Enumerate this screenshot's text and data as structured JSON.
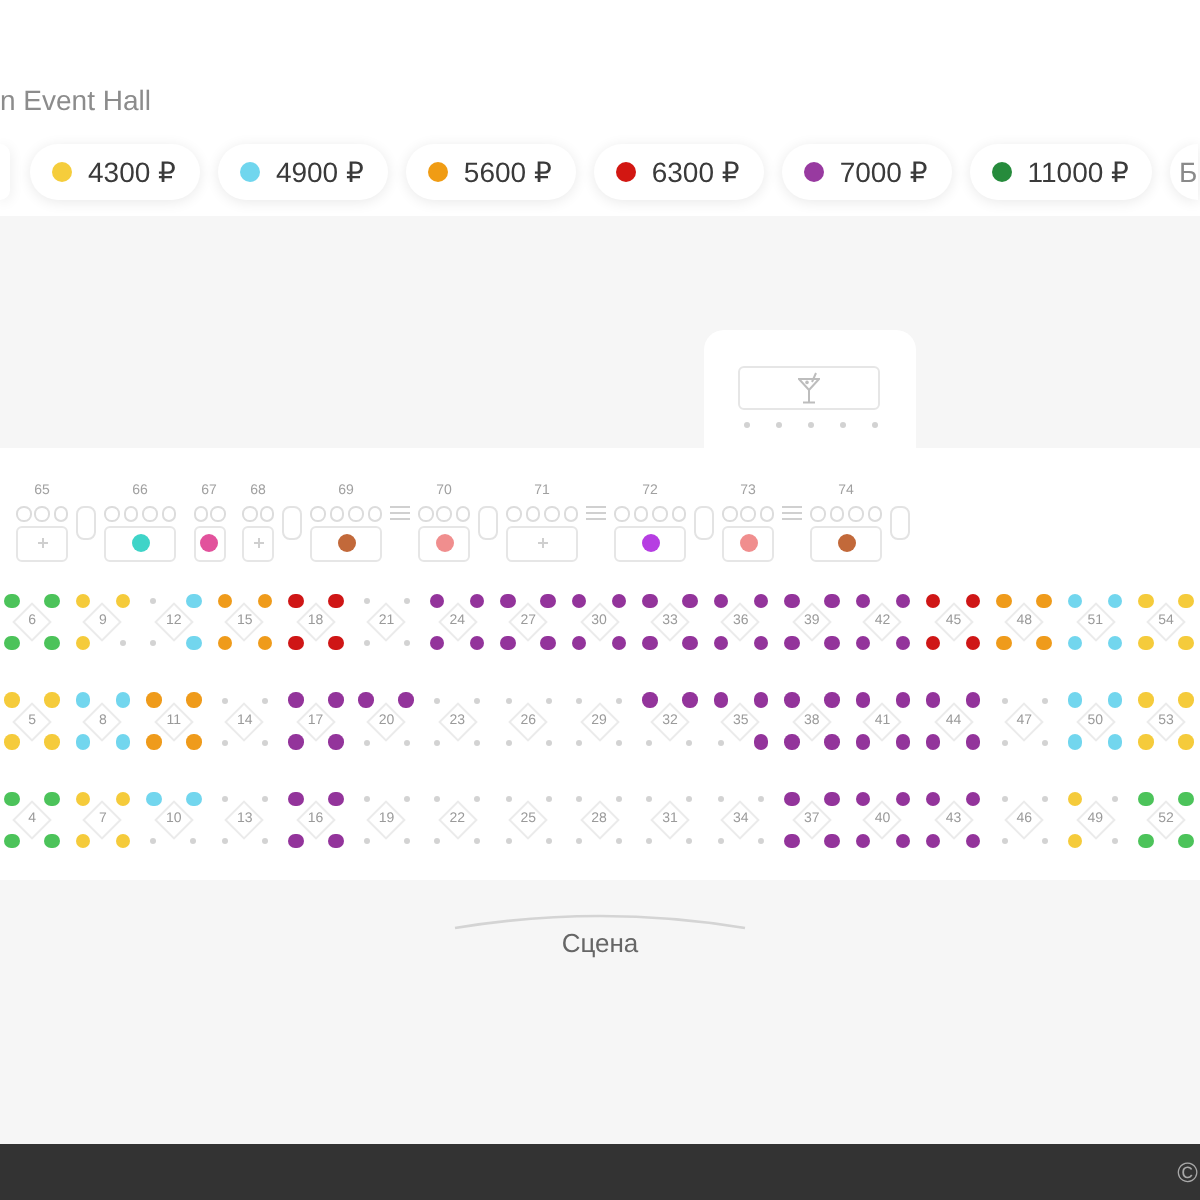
{
  "venue": {
    "title": "n Event Hall"
  },
  "price_legend": [
    {
      "label": "4300 ₽",
      "color": "#f5cd3c"
    },
    {
      "label": "4900 ₽",
      "color": "#70d6ee"
    },
    {
      "label": "5600 ₽",
      "color": "#f09c14"
    },
    {
      "label": "6300 ₽",
      "color": "#d21712"
    },
    {
      "label": "7000 ₽",
      "color": "#983aa0"
    },
    {
      "label": "11000 ₽",
      "color": "#268b3c"
    },
    {
      "label": "Б"
    }
  ],
  "bar": {
    "stools": [
      {
        "available": false
      },
      {
        "available": false
      },
      {
        "available": false
      },
      {
        "available": false
      },
      {
        "available": false
      }
    ]
  },
  "booths": [
    {
      "kind": "booth",
      "number": "65",
      "chairs": [
        {
          "available": false
        },
        {
          "available": false
        },
        {
          "available": false
        }
      ],
      "available": false
    },
    {
      "kind": "sofa"
    },
    {
      "kind": "booth",
      "number": "66",
      "chairs": [
        {
          "available": false
        },
        {
          "available": false
        },
        {
          "available": false
        },
        {
          "available": false
        }
      ],
      "available": true,
      "color": "#3fd4c8"
    },
    {
      "kind": "booth",
      "number": "67",
      "chairs": [
        {
          "available": false
        },
        {
          "available": false
        }
      ],
      "available": true,
      "color": "#e2529c"
    },
    {
      "kind": "booth",
      "number": "68",
      "chairs": [
        {
          "available": false
        },
        {
          "available": false
        }
      ],
      "available": false
    },
    {
      "kind": "sofa"
    },
    {
      "kind": "booth",
      "number": "69",
      "chairs": [
        {
          "available": false
        },
        {
          "available": false
        },
        {
          "available": false
        },
        {
          "available": false
        }
      ],
      "available": true,
      "color": "#c2693a"
    },
    {
      "kind": "divider"
    },
    {
      "kind": "booth",
      "number": "70",
      "chairs": [
        {
          "available": false
        },
        {
          "available": false
        },
        {
          "available": false
        }
      ],
      "available": true,
      "color": "#f08e8e"
    },
    {
      "kind": "sofa"
    },
    {
      "kind": "booth",
      "number": "71",
      "chairs": [
        {
          "available": false
        },
        {
          "available": false
        },
        {
          "available": false
        },
        {
          "available": false
        }
      ],
      "available": false
    },
    {
      "kind": "divider"
    },
    {
      "kind": "booth",
      "number": "72",
      "chairs": [
        {
          "available": false
        },
        {
          "available": false
        },
        {
          "available": false
        },
        {
          "available": false
        }
      ],
      "available": true,
      "color": "#b63ee2"
    },
    {
      "kind": "sofa"
    },
    {
      "kind": "booth",
      "number": "73",
      "chairs": [
        {
          "available": false
        },
        {
          "available": false
        },
        {
          "available": false
        }
      ],
      "available": true,
      "color": "#f08e8e"
    },
    {
      "kind": "divider"
    },
    {
      "kind": "booth",
      "number": "74",
      "chairs": [
        {
          "available": false
        },
        {
          "available": false
        },
        {
          "available": false
        },
        {
          "available": false
        }
      ],
      "available": true,
      "color": "#c2693a"
    },
    {
      "kind": "sofa"
    }
  ],
  "table_rows": [
    {
      "tables": [
        {
          "number": "6",
          "seats": [
            {
              "available": true,
              "color": "#4cc35a"
            },
            {
              "available": true,
              "color": "#4cc35a"
            },
            {
              "available": true,
              "color": "#4cc35a"
            },
            {
              "available": true,
              "color": "#4cc35a"
            }
          ]
        },
        {
          "number": "9",
          "seats": [
            {
              "available": true,
              "color": "#f5cb3b"
            },
            {
              "available": true,
              "color": "#f5cb3b"
            },
            {
              "available": true,
              "color": "#f5cb3b"
            },
            {
              "available": false
            }
          ]
        },
        {
          "number": "12",
          "seats": [
            {
              "available": false
            },
            {
              "available": true,
              "color": "#72d6ee"
            },
            {
              "available": false
            },
            {
              "available": true,
              "color": "#72d6ee"
            }
          ]
        },
        {
          "number": "15",
          "seats": [
            {
              "available": true,
              "color": "#ef9b1b"
            },
            {
              "available": true,
              "color": "#ef9b1b"
            },
            {
              "available": true,
              "color": "#ef9b1b"
            },
            {
              "available": true,
              "color": "#ef9b1b"
            }
          ]
        },
        {
          "number": "18",
          "seats": [
            {
              "available": true,
              "color": "#cf1616"
            },
            {
              "available": true,
              "color": "#cf1616"
            },
            {
              "available": true,
              "color": "#cf1616"
            },
            {
              "available": true,
              "color": "#cf1616"
            }
          ]
        },
        {
          "number": "21",
          "seats": [
            {
              "available": false
            },
            {
              "available": false
            },
            {
              "available": false
            },
            {
              "available": false
            }
          ]
        },
        {
          "number": "24",
          "seats": [
            {
              "available": true,
              "color": "#93349b"
            },
            {
              "available": true,
              "color": "#93349b"
            },
            {
              "available": true,
              "color": "#93349b"
            },
            {
              "available": true,
              "color": "#93349b"
            }
          ]
        },
        {
          "number": "27",
          "seats": [
            {
              "available": true,
              "color": "#93349b"
            },
            {
              "available": true,
              "color": "#93349b"
            },
            {
              "available": true,
              "color": "#93349b"
            },
            {
              "available": true,
              "color": "#93349b"
            }
          ]
        },
        {
          "number": "30",
          "seats": [
            {
              "available": true,
              "color": "#93349b"
            },
            {
              "available": true,
              "color": "#93349b"
            },
            {
              "available": true,
              "color": "#93349b"
            },
            {
              "available": true,
              "color": "#93349b"
            }
          ]
        },
        {
          "number": "33",
          "seats": [
            {
              "available": true,
              "color": "#93349b"
            },
            {
              "available": true,
              "color": "#93349b"
            },
            {
              "available": true,
              "color": "#93349b"
            },
            {
              "available": true,
              "color": "#93349b"
            }
          ]
        },
        {
          "number": "36",
          "seats": [
            {
              "available": true,
              "color": "#93349b"
            },
            {
              "available": true,
              "color": "#93349b"
            },
            {
              "available": true,
              "color": "#93349b"
            },
            {
              "available": true,
              "color": "#93349b"
            }
          ]
        },
        {
          "number": "39",
          "seats": [
            {
              "available": true,
              "color": "#93349b"
            },
            {
              "available": true,
              "color": "#93349b"
            },
            {
              "available": true,
              "color": "#93349b"
            },
            {
              "available": true,
              "color": "#93349b"
            }
          ]
        },
        {
          "number": "42",
          "seats": [
            {
              "available": true,
              "color": "#93349b"
            },
            {
              "available": true,
              "color": "#93349b"
            },
            {
              "available": true,
              "color": "#93349b"
            },
            {
              "available": true,
              "color": "#93349b"
            }
          ]
        },
        {
          "number": "45",
          "seats": [
            {
              "available": true,
              "color": "#cf1616"
            },
            {
              "available": true,
              "color": "#cf1616"
            },
            {
              "available": true,
              "color": "#cf1616"
            },
            {
              "available": true,
              "color": "#cf1616"
            }
          ]
        },
        {
          "number": "48",
          "seats": [
            {
              "available": true,
              "color": "#ef9b1b"
            },
            {
              "available": true,
              "color": "#ef9b1b"
            },
            {
              "available": true,
              "color": "#ef9b1b"
            },
            {
              "available": true,
              "color": "#ef9b1b"
            }
          ]
        },
        {
          "number": "51",
          "seats": [
            {
              "available": true,
              "color": "#72d6ee"
            },
            {
              "available": true,
              "color": "#72d6ee"
            },
            {
              "available": true,
              "color": "#72d6ee"
            },
            {
              "available": true,
              "color": "#72d6ee"
            }
          ]
        },
        {
          "number": "54",
          "seats": [
            {
              "available": true,
              "color": "#f5cb3b"
            },
            {
              "available": true,
              "color": "#f5cb3b"
            },
            {
              "available": true,
              "color": "#f5cb3b"
            },
            {
              "available": true,
              "color": "#f5cb3b"
            }
          ]
        }
      ]
    },
    {
      "tables": [
        {
          "number": "5",
          "seats": [
            {
              "available": true,
              "color": "#f5cb3b"
            },
            {
              "available": true,
              "color": "#f5cb3b"
            },
            {
              "available": true,
              "color": "#f5cb3b"
            },
            {
              "available": true,
              "color": "#f5cb3b"
            }
          ]
        },
        {
          "number": "8",
          "seats": [
            {
              "available": true,
              "color": "#72d6ee"
            },
            {
              "available": true,
              "color": "#72d6ee"
            },
            {
              "available": true,
              "color": "#72d6ee"
            },
            {
              "available": true,
              "color": "#72d6ee"
            }
          ]
        },
        {
          "number": "11",
          "seats": [
            {
              "available": true,
              "color": "#ef9b1b"
            },
            {
              "available": true,
              "color": "#ef9b1b"
            },
            {
              "available": true,
              "color": "#ef9b1b"
            },
            {
              "available": true,
              "color": "#ef9b1b"
            }
          ]
        },
        {
          "number": "14",
          "seats": [
            {
              "available": false
            },
            {
              "available": false
            },
            {
              "available": false
            },
            {
              "available": false
            }
          ]
        },
        {
          "number": "17",
          "seats": [
            {
              "available": true,
              "color": "#93349b"
            },
            {
              "available": true,
              "color": "#93349b"
            },
            {
              "available": true,
              "color": "#93349b"
            },
            {
              "available": true,
              "color": "#93349b"
            }
          ]
        },
        {
          "number": "20",
          "seats": [
            {
              "available": true,
              "color": "#93349b"
            },
            {
              "available": true,
              "color": "#93349b"
            },
            {
              "available": false
            },
            {
              "available": false
            }
          ]
        },
        {
          "number": "23",
          "seats": [
            {
              "available": false
            },
            {
              "available": false
            },
            {
              "available": false
            },
            {
              "available": false
            }
          ]
        },
        {
          "number": "26",
          "seats": [
            {
              "available": false
            },
            {
              "available": false
            },
            {
              "available": false
            },
            {
              "available": false
            }
          ]
        },
        {
          "number": "29",
          "seats": [
            {
              "available": false
            },
            {
              "available": false
            },
            {
              "available": false
            },
            {
              "available": false
            }
          ]
        },
        {
          "number": "32",
          "seats": [
            {
              "available": true,
              "color": "#93349b"
            },
            {
              "available": true,
              "color": "#93349b"
            },
            {
              "available": false
            },
            {
              "available": false
            }
          ]
        },
        {
          "number": "35",
          "seats": [
            {
              "available": true,
              "color": "#93349b"
            },
            {
              "available": true,
              "color": "#93349b"
            },
            {
              "available": false
            },
            {
              "available": true,
              "color": "#93349b"
            }
          ]
        },
        {
          "number": "38",
          "seats": [
            {
              "available": true,
              "color": "#93349b"
            },
            {
              "available": true,
              "color": "#93349b"
            },
            {
              "available": true,
              "color": "#93349b"
            },
            {
              "available": true,
              "color": "#93349b"
            }
          ]
        },
        {
          "number": "41",
          "seats": [
            {
              "available": true,
              "color": "#93349b"
            },
            {
              "available": true,
              "color": "#93349b"
            },
            {
              "available": true,
              "color": "#93349b"
            },
            {
              "available": true,
              "color": "#93349b"
            }
          ]
        },
        {
          "number": "44",
          "seats": [
            {
              "available": true,
              "color": "#93349b"
            },
            {
              "available": true,
              "color": "#93349b"
            },
            {
              "available": true,
              "color": "#93349b"
            },
            {
              "available": true,
              "color": "#93349b"
            }
          ]
        },
        {
          "number": "47",
          "seats": [
            {
              "available": false
            },
            {
              "available": false
            },
            {
              "available": false
            },
            {
              "available": false
            }
          ]
        },
        {
          "number": "50",
          "seats": [
            {
              "available": true,
              "color": "#72d6ee"
            },
            {
              "available": true,
              "color": "#72d6ee"
            },
            {
              "available": true,
              "color": "#72d6ee"
            },
            {
              "available": true,
              "color": "#72d6ee"
            }
          ]
        },
        {
          "number": "53",
          "seats": [
            {
              "available": true,
              "color": "#f5cb3b"
            },
            {
              "available": true,
              "color": "#f5cb3b"
            },
            {
              "available": true,
              "color": "#f5cb3b"
            },
            {
              "available": true,
              "color": "#f5cb3b"
            }
          ]
        }
      ]
    },
    {
      "tables": [
        {
          "number": "4",
          "seats": [
            {
              "available": true,
              "color": "#4cc35a"
            },
            {
              "available": true,
              "color": "#4cc35a"
            },
            {
              "available": true,
              "color": "#4cc35a"
            },
            {
              "available": true,
              "color": "#4cc35a"
            }
          ]
        },
        {
          "number": "7",
          "seats": [
            {
              "available": true,
              "color": "#f5cb3b"
            },
            {
              "available": true,
              "color": "#f5cb3b"
            },
            {
              "available": true,
              "color": "#f5cb3b"
            },
            {
              "available": true,
              "color": "#f5cb3b"
            }
          ]
        },
        {
          "number": "10",
          "seats": [
            {
              "available": true,
              "color": "#72d6ee"
            },
            {
              "available": true,
              "color": "#72d6ee"
            },
            {
              "available": false
            },
            {
              "available": false
            }
          ]
        },
        {
          "number": "13",
          "seats": [
            {
              "available": false
            },
            {
              "available": false
            },
            {
              "available": false
            },
            {
              "available": false
            }
          ]
        },
        {
          "number": "16",
          "seats": [
            {
              "available": true,
              "color": "#93349b"
            },
            {
              "available": true,
              "color": "#93349b"
            },
            {
              "available": true,
              "color": "#93349b"
            },
            {
              "available": true,
              "color": "#93349b"
            }
          ]
        },
        {
          "number": "19",
          "seats": [
            {
              "available": false
            },
            {
              "available": false
            },
            {
              "available": false
            },
            {
              "available": false
            }
          ]
        },
        {
          "number": "22",
          "seats": [
            {
              "available": false
            },
            {
              "available": false
            },
            {
              "available": false
            },
            {
              "available": false
            }
          ]
        },
        {
          "number": "25",
          "seats": [
            {
              "available": false
            },
            {
              "available": false
            },
            {
              "available": false
            },
            {
              "available": false
            }
          ]
        },
        {
          "number": "28",
          "seats": [
            {
              "available": false
            },
            {
              "available": false
            },
            {
              "available": false
            },
            {
              "available": false
            }
          ]
        },
        {
          "number": "31",
          "seats": [
            {
              "available": false
            },
            {
              "available": false
            },
            {
              "available": false
            },
            {
              "available": false
            }
          ]
        },
        {
          "number": "34",
          "seats": [
            {
              "available": false
            },
            {
              "available": false
            },
            {
              "available": false
            },
            {
              "available": false
            }
          ]
        },
        {
          "number": "37",
          "seats": [
            {
              "available": true,
              "color": "#93349b"
            },
            {
              "available": true,
              "color": "#93349b"
            },
            {
              "available": true,
              "color": "#93349b"
            },
            {
              "available": true,
              "color": "#93349b"
            }
          ]
        },
        {
          "number": "40",
          "seats": [
            {
              "available": true,
              "color": "#93349b"
            },
            {
              "available": true,
              "color": "#93349b"
            },
            {
              "available": true,
              "color": "#93349b"
            },
            {
              "available": true,
              "color": "#93349b"
            }
          ]
        },
        {
          "number": "43",
          "seats": [
            {
              "available": true,
              "color": "#93349b"
            },
            {
              "available": true,
              "color": "#93349b"
            },
            {
              "available": true,
              "color": "#93349b"
            },
            {
              "available": true,
              "color": "#93349b"
            }
          ]
        },
        {
          "number": "46",
          "seats": [
            {
              "available": false
            },
            {
              "available": false
            },
            {
              "available": false
            },
            {
              "available": false
            }
          ]
        },
        {
          "number": "49",
          "seats": [
            {
              "available": true,
              "color": "#f5cb3b"
            },
            {
              "available": false
            },
            {
              "available": true,
              "color": "#f5cb3b"
            },
            {
              "available": false
            }
          ]
        },
        {
          "number": "52",
          "seats": [
            {
              "available": true,
              "color": "#4cc35a"
            },
            {
              "available": true,
              "color": "#4cc35a"
            },
            {
              "available": true,
              "color": "#4cc35a"
            },
            {
              "available": true,
              "color": "#4cc35a"
            }
          ]
        }
      ]
    }
  ],
  "stage": {
    "label": "Сцена"
  },
  "footer": {
    "text": "©"
  }
}
